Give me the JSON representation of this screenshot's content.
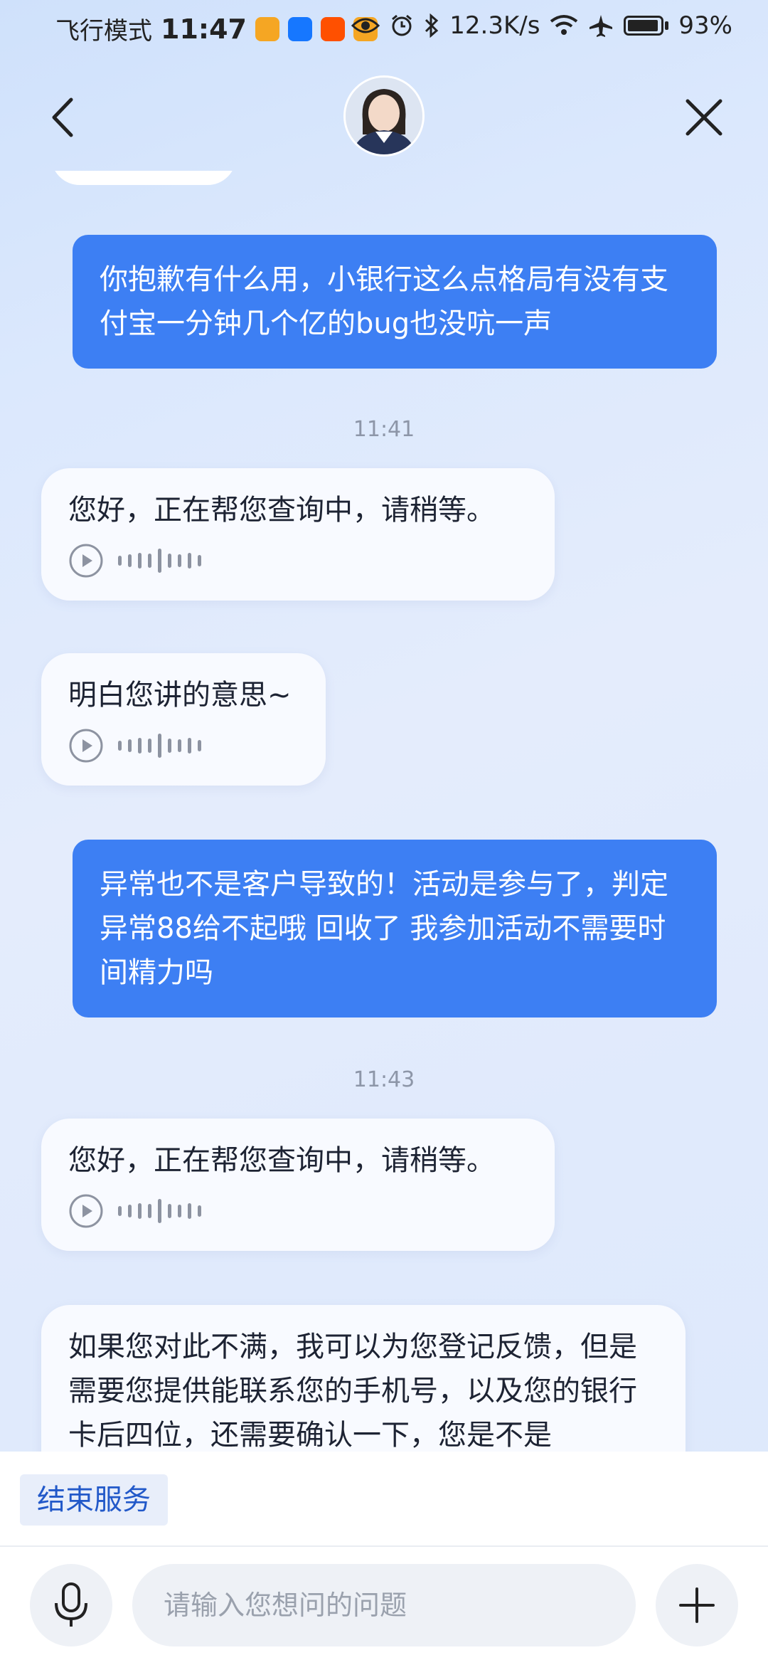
{
  "status_bar": {
    "mode": "飞行模式",
    "time": "11:47",
    "speed": "12.3K/s",
    "battery": "93%"
  },
  "header": {
    "back_icon": "chevron-left-icon",
    "close_icon": "close-icon"
  },
  "messages": {
    "user_1": "你抱歉有什么用，小银行这么点格局有没有支付宝一分钟几个亿的bug也没吭一声",
    "time_1": "11:41",
    "bot_1": "您好，正在帮您查询中，请稍等。",
    "bot_2": "明白您讲的意思~",
    "user_2": "异常也不是客户导致的！活动是参与了，判定异常88给不起哦 回收了 我参加活动不需要时间精力吗",
    "time_2": "11:43",
    "bot_3": "您好，正在帮您查询中，请稍等。",
    "bot_4": "如果您对此不满，我可以为您登记反馈，但是需要您提供能联系您的手机号，以及您的银行卡后四位，还需要确认一下，您是不是"
  },
  "bottom": {
    "end_service": "结束服务",
    "input_placeholder": "请输入您想问的问题"
  },
  "colors": {
    "user_bubble": "#3d7ff3",
    "bot_bubble": "#f8faff",
    "accent_text": "#2259c9"
  }
}
